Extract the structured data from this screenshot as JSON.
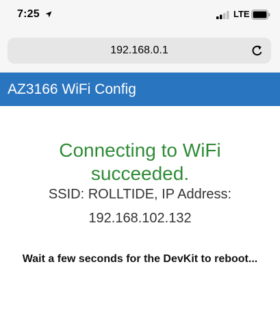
{
  "status_bar": {
    "time": "7:25",
    "network": "LTE",
    "icons": [
      "location-arrow-icon",
      "signal-bars-icon",
      "battery-icon"
    ]
  },
  "browser": {
    "url": "192.168.0.1",
    "reload_icon": "reload-icon"
  },
  "page": {
    "header_title": "AZ3166 WiFi Config",
    "success_message": "Connecting to WiFi succeeded.",
    "ssid_info": "SSID: ROLLTIDE, IP Address:",
    "ip_address": "192.168.102.132",
    "wait_message": "Wait a few seconds for the DevKit to reboot..."
  },
  "colors": {
    "header_bg": "#2a75bf",
    "success_text": "#2e8b35",
    "body_text": "#333333"
  }
}
